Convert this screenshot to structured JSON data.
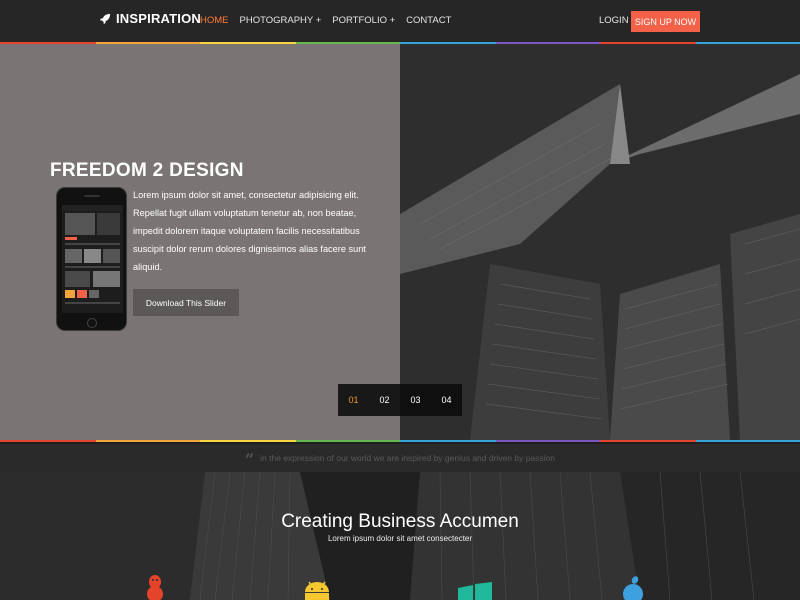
{
  "nav": {
    "logo": "INSPIRATION",
    "menu": [
      "HOME",
      "PHOTOGRAPHY +",
      "PORTFOLIO +",
      "CONTACT"
    ],
    "login": "LOGIN",
    "signup": "SIGN UP NOW"
  },
  "hero": {
    "title": "FREEDOM 2 DESIGN",
    "text": "Lorem ipsum dolor sit amet, consectetur adipisicing elit. Repellat fugit ullam voluptatum tenetur ab, non beatae, impedit dolorem itaque voluptatem facilis necessitatibus suscipit dolor rerum dolores dignissimos alias facere sunt aliquid.",
    "button": "Download This Slider",
    "pager": [
      "01",
      "02",
      "03",
      "04"
    ],
    "pager_active": "01"
  },
  "quote": "in the expression of our world we are inspired by genius and driven by passion",
  "section": {
    "title": "Creating Business Accumen",
    "subtitle": "Lorem ipsum dolor sit amet consectecter"
  },
  "icons": [
    "rocket-icon",
    "quote-icon",
    "linux-icon",
    "android-icon",
    "windows-icon",
    "apple-icon"
  ],
  "colors": {
    "accent": "#ff7a3a",
    "signup": "#f26148",
    "pager_active": "#f19a2c",
    "linux": "#e5432a",
    "android": "#f6c72f",
    "windows": "#1fb89a",
    "apple": "#3fa0e0"
  }
}
